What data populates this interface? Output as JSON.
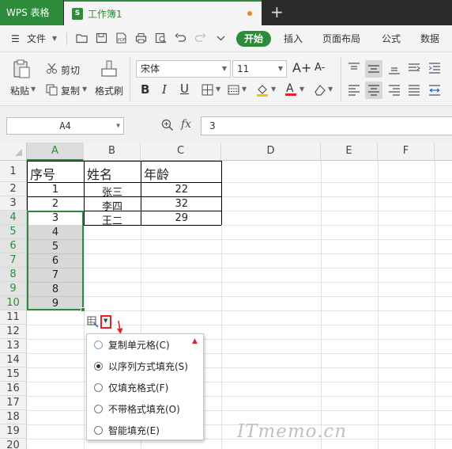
{
  "titlebar": {
    "app_name": "WPS 表格",
    "doc_icon": "S",
    "doc_name": "工作簿1",
    "new_tab": "+"
  },
  "menubar": {
    "hamburger": "☰",
    "file_label": "文件",
    "quick_icons": [
      "folder-icon",
      "save-icon",
      "pdf-icon",
      "print-icon",
      "print-preview-icon",
      "undo-icon",
      "redo-icon",
      "more-icon"
    ],
    "tabs": [
      "开始",
      "插入",
      "页面布局",
      "公式",
      "数据"
    ]
  },
  "ribbon": {
    "paste": "粘贴",
    "cut": "剪切",
    "copy": "复制",
    "format_painter": "格式刷",
    "font_name": "宋体",
    "font_size": "11",
    "font_grow": "A+",
    "font_shrink": "A-",
    "bold": "B",
    "italic": "I",
    "underline": "U"
  },
  "formula_bar": {
    "name_box": "A4",
    "fx": "fx",
    "value": "3"
  },
  "grid": {
    "columns": [
      "A",
      "B",
      "C",
      "D",
      "E",
      "F"
    ],
    "rows": [
      "1",
      "2",
      "3",
      "4",
      "5",
      "6",
      "7",
      "8",
      "9",
      "10",
      "11",
      "12",
      "13",
      "14",
      "15",
      "16",
      "17",
      "18",
      "19",
      "20"
    ],
    "header_row": [
      "序号",
      "姓名",
      "年龄"
    ],
    "data_rows": [
      [
        "1",
        "张三",
        "22"
      ],
      [
        "2",
        "李四",
        "32"
      ],
      [
        "3",
        "王二",
        "29"
      ]
    ],
    "filled_series": [
      "4",
      "5",
      "6",
      "7",
      "8",
      "9"
    ]
  },
  "autofill_menu": {
    "options": [
      {
        "label": "复制单元格(C)",
        "selected": false
      },
      {
        "label": "以序列方式填充(S)",
        "selected": true
      },
      {
        "label": "仅填充格式(F)",
        "selected": false
      },
      {
        "label": "不带格式填充(O)",
        "selected": false
      },
      {
        "label": "智能填充(E)",
        "selected": false
      }
    ]
  },
  "colors": {
    "brand": "#2e8b3c",
    "selection": "#2e8b3c",
    "highlight": "#e0242b",
    "fill_range": "#d8d8d8"
  },
  "watermark": "ITmemo.cn"
}
